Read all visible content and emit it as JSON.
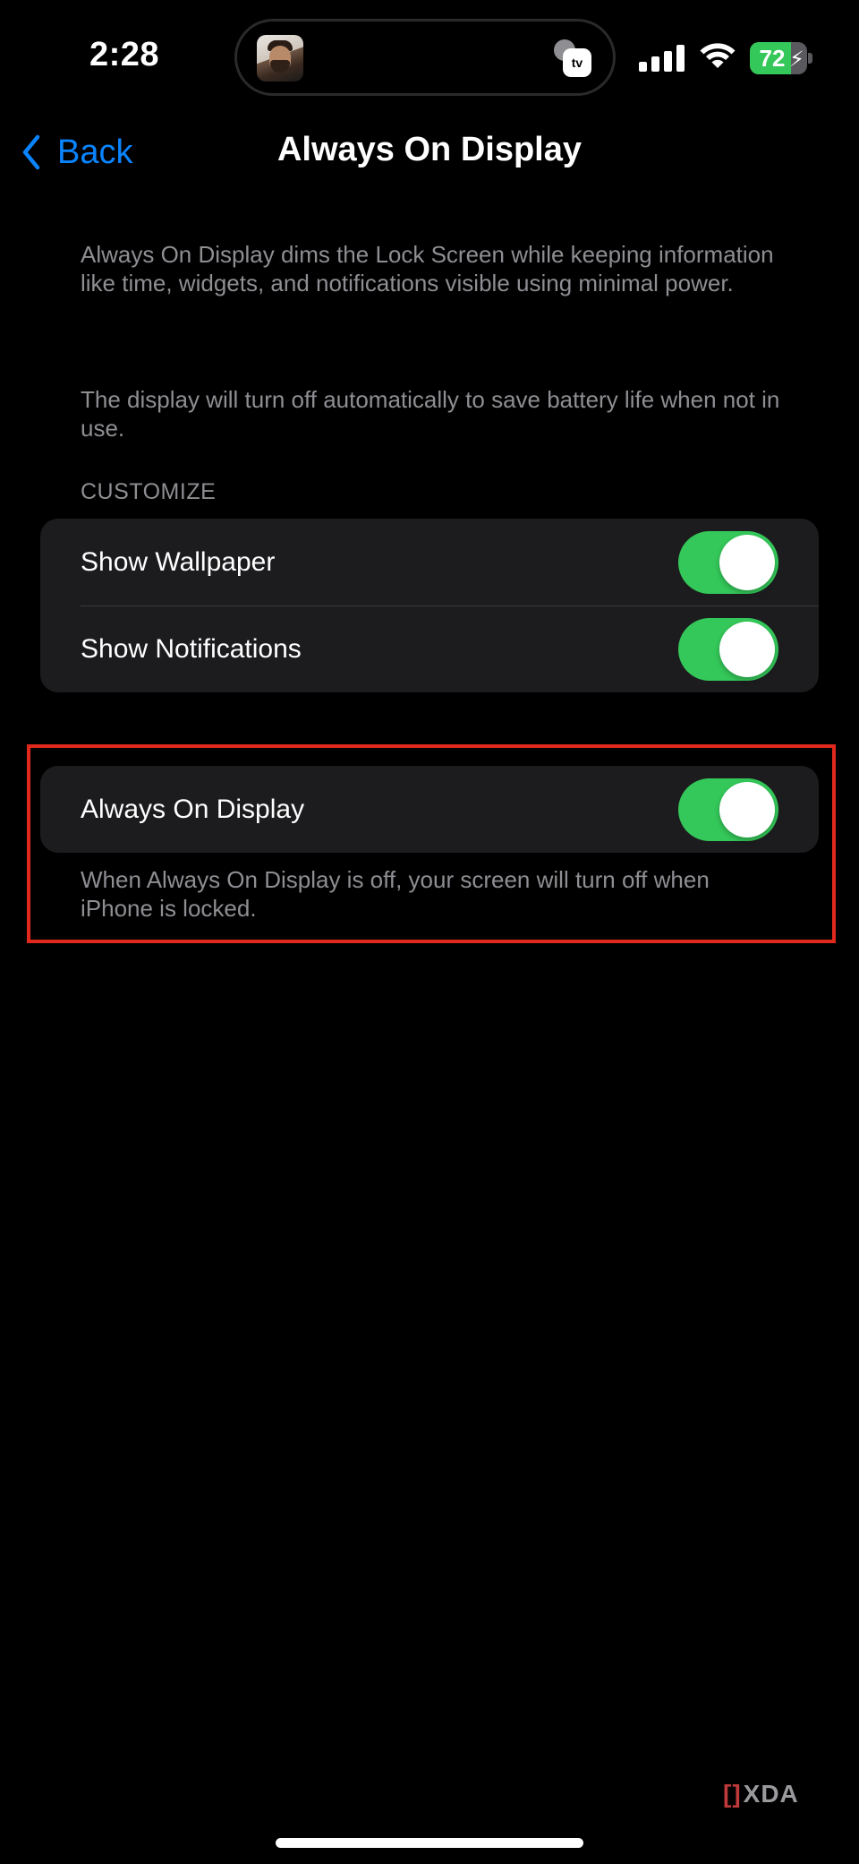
{
  "status_bar": {
    "time": "2:28",
    "battery_percent": "72",
    "battery_level": 0.72,
    "signal_icon": "cellular-signal-icon",
    "wifi_icon": "wifi-icon",
    "charging_icon": "charging-bolt-icon",
    "live_activity_icon": "apple-tv-icon",
    "live_activity_tv_label": "tv"
  },
  "nav": {
    "back_label": "Back",
    "title": "Always On Display"
  },
  "intro": {
    "paragraph_1": "Always On Display dims the Lock Screen while keeping information like time, widgets, and notifications visible using minimal power.",
    "paragraph_2": "The display will turn off automatically to save battery life when not in use."
  },
  "customize": {
    "header": "CUSTOMIZE",
    "rows": [
      {
        "label": "Show Wallpaper",
        "on": true
      },
      {
        "label": "Show Notifications",
        "on": true
      }
    ]
  },
  "aod": {
    "label": "Always On Display",
    "on": true,
    "footer": "When Always On Display is off, your screen will turn off when iPhone is locked."
  },
  "watermark": {
    "text": "XDA"
  },
  "colors": {
    "accent_blue": "#0a84ff",
    "toggle_on": "#34c759",
    "highlight_red": "#e0291c",
    "cell_bg": "#1c1c1e",
    "secondary_text": "#8e8e93"
  }
}
